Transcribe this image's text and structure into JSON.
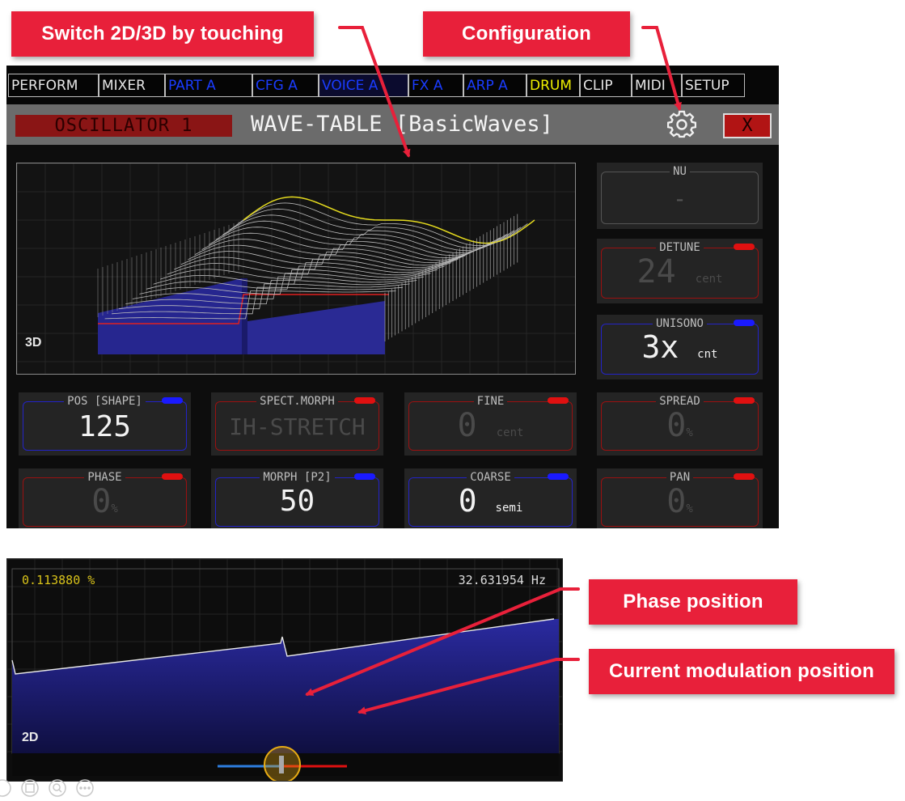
{
  "annotations": {
    "switch_2d3d": "Switch 2D/3D by touching",
    "configuration": "Configuration",
    "phase_position": "Phase position",
    "modulation_position": "Current modulation position"
  },
  "tabs": [
    {
      "label": "PERFORM",
      "color": "#e6e6e6"
    },
    {
      "label": "MIXER",
      "color": "#e6e6e6"
    },
    {
      "label": "PART A",
      "color": "#1a3cff"
    },
    {
      "label": "CFG A",
      "color": "#1a3cff"
    },
    {
      "label": "VOICE A",
      "color": "#1a3cff",
      "active": true
    },
    {
      "label": "FX A",
      "color": "#1a3cff"
    },
    {
      "label": "ARP A",
      "color": "#1a3cff"
    },
    {
      "label": "DRUM",
      "color": "#f0f000"
    },
    {
      "label": "CLIP",
      "color": "#e6e6e6"
    },
    {
      "label": "MIDI",
      "color": "#e6e6e6"
    },
    {
      "label": "SETUP",
      "color": "#e6e6e6"
    }
  ],
  "titlebar": {
    "section": "OSCILLATOR 1",
    "title": "WAVE-TABLE [BasicWaves]",
    "close": "X",
    "config_icon": "gear-icon"
  },
  "wave_view_3d": {
    "mode_label": "3D"
  },
  "controls": {
    "nu": {
      "label": "NU",
      "value": "-",
      "unit": "",
      "frame_color": "#555555",
      "dot": null
    },
    "detune": {
      "label": "DETUNE",
      "value": "24",
      "unit": "cent",
      "frame_color": "#9b1010",
      "dot": "#e01010",
      "value_color": "#4a4a4a"
    },
    "unisono": {
      "label": "UNISONO",
      "value": "3x",
      "unit": "cnt",
      "frame_color": "#2323c8",
      "dot": "#1a1aff",
      "value_color": "#f2f2f2"
    },
    "pos": {
      "label": "POS [SHAPE]",
      "value": "125",
      "unit": "",
      "frame_color": "#2323c8",
      "dot": "#1a1aff",
      "value_color": "#f2f2f2"
    },
    "spect_morph": {
      "label": "SPECT.MORPH",
      "value": "IH-STRETCH",
      "unit": "",
      "frame_color": "#9b1010",
      "dot": "#e01010",
      "value_color": "#4a4a4a"
    },
    "fine": {
      "label": "FINE",
      "value": "0",
      "unit": "cent",
      "frame_color": "#9b1010",
      "dot": "#e01010",
      "value_color": "#4a4a4a"
    },
    "spread": {
      "label": "SPREAD",
      "value": "0",
      "unit": "%",
      "frame_color": "#9b1010",
      "dot": "#e01010",
      "value_color": "#4a4a4a"
    },
    "phase": {
      "label": "PHASE",
      "value": "0",
      "unit": "%",
      "frame_color": "#9b1010",
      "dot": "#e01010",
      "value_color": "#4a4a4a"
    },
    "morph": {
      "label": "MORPH [P2]",
      "value": "50",
      "unit": "",
      "frame_color": "#2323c8",
      "dot": "#1a1aff",
      "value_color": "#f2f2f2"
    },
    "coarse": {
      "label": "COARSE",
      "value": "0",
      "unit": "semi",
      "frame_color": "#2323c8",
      "dot": "#1a1aff",
      "value_color": "#f2f2f2"
    },
    "pan": {
      "label": "PAN",
      "value": "0",
      "unit": "%",
      "frame_color": "#9b1010",
      "dot": "#e01010",
      "value_color": "#4a4a4a"
    }
  },
  "wave_view_2d": {
    "mode_label": "2D",
    "phase_readout": "0.113880 %",
    "freq_readout": "32.631954 Hz"
  },
  "colors": {
    "callout": "#e8203a",
    "wave_fill": "#2a2a9a",
    "highlight_red": "#e01010",
    "highlight_yellow": "#e8e020"
  }
}
